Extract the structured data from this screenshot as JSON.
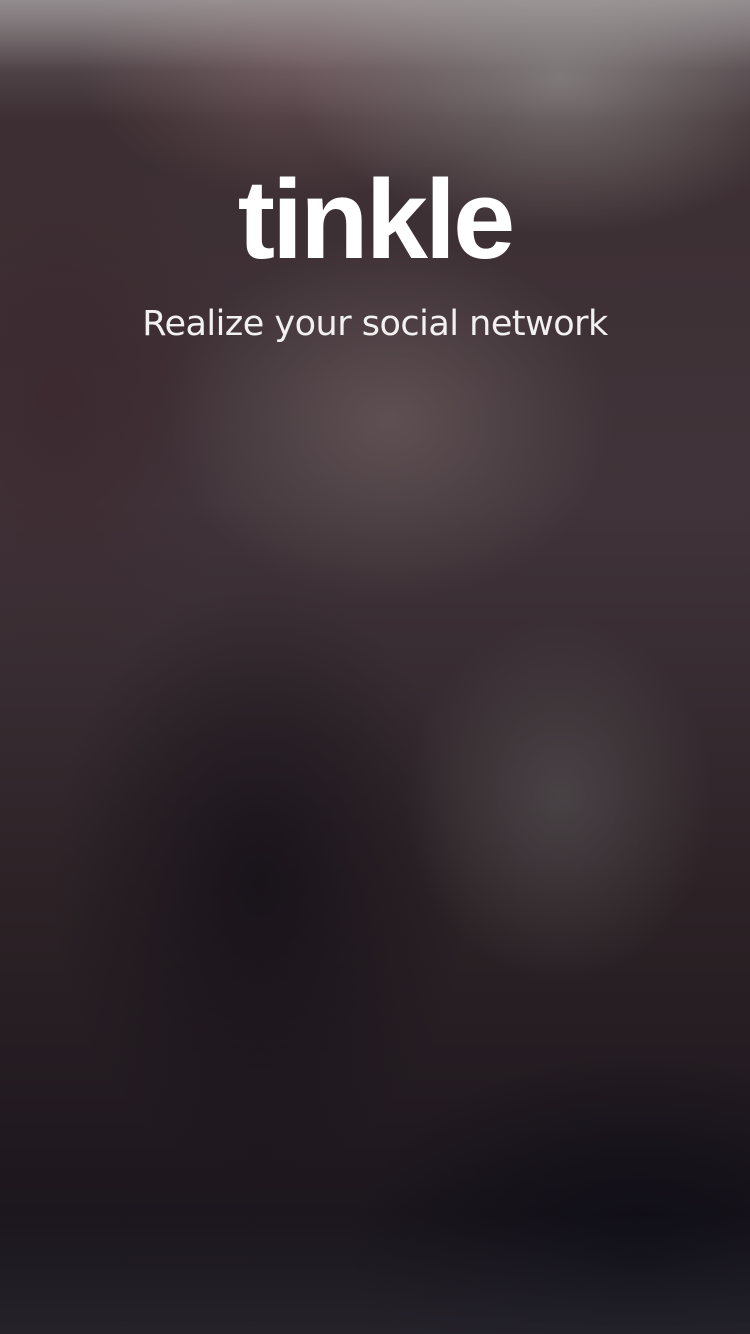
{
  "app": {
    "logo_text": "tinkle",
    "tagline": "Realize your social network"
  },
  "colors": {
    "text": "#ffffff",
    "background_top": "#6a6064",
    "background_mid": "#40343a",
    "background_bottom": "#16121a"
  }
}
